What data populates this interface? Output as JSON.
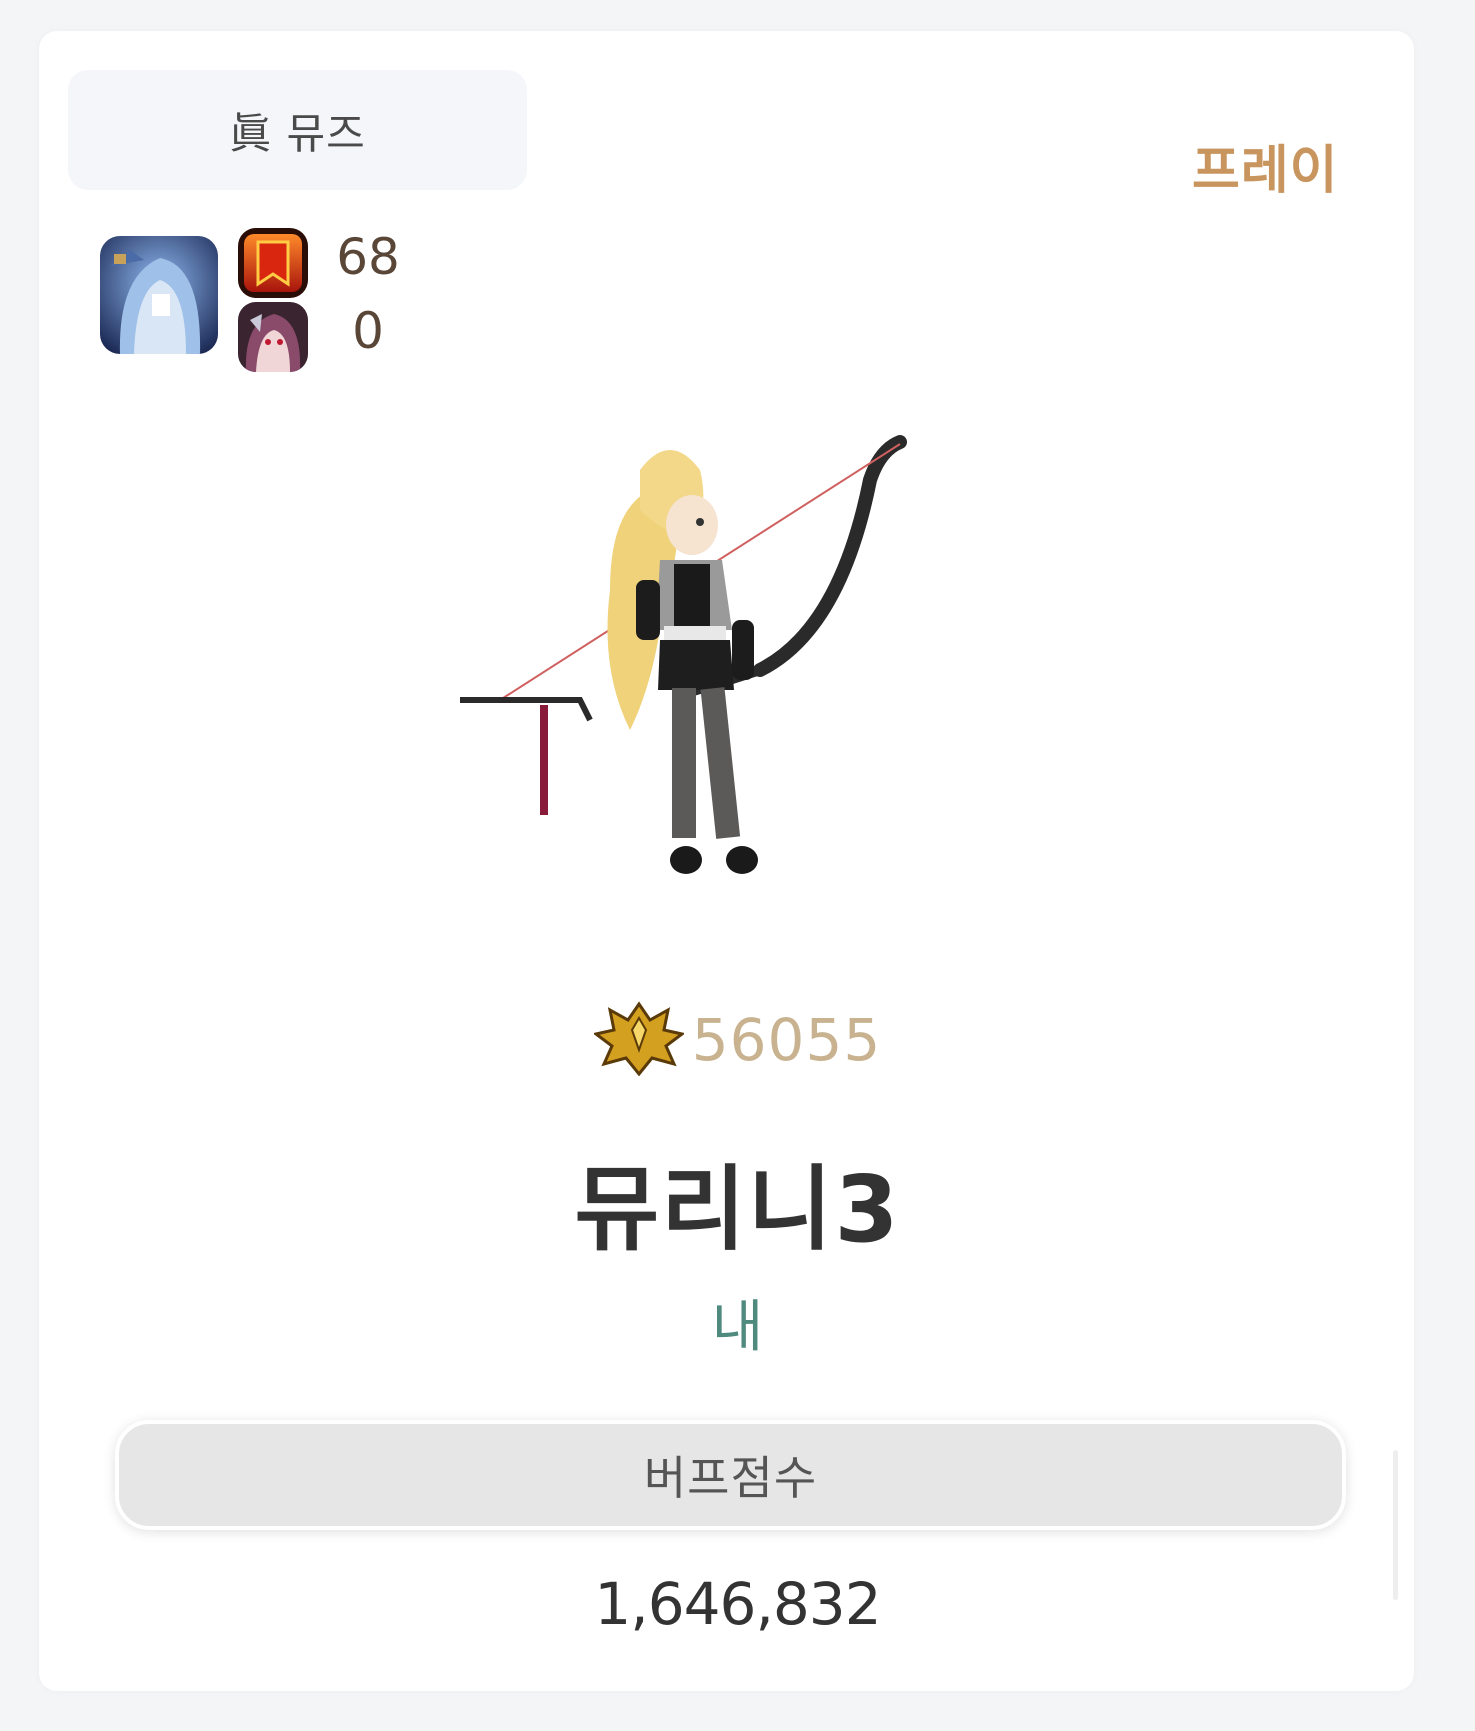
{
  "card": {
    "class_tab_label": "眞 뮤즈",
    "server": "프레이"
  },
  "stats": {
    "level_icon": "red-banner-icon",
    "level_value": "68",
    "companion_icon": "companion-portrait-icon",
    "companion_value": "0"
  },
  "avatar_icon": "character-portrait-icon",
  "fame": {
    "icon": "fame-emblem-icon",
    "value": "56055"
  },
  "character": {
    "name": "뮤리니3",
    "guild": "내"
  },
  "buff": {
    "label": "버프점수",
    "value": "1,646,832"
  },
  "colors": {
    "server": "#c9955e",
    "fame": "#c8b290",
    "guild": "#4f8a7e",
    "name": "#333333"
  }
}
